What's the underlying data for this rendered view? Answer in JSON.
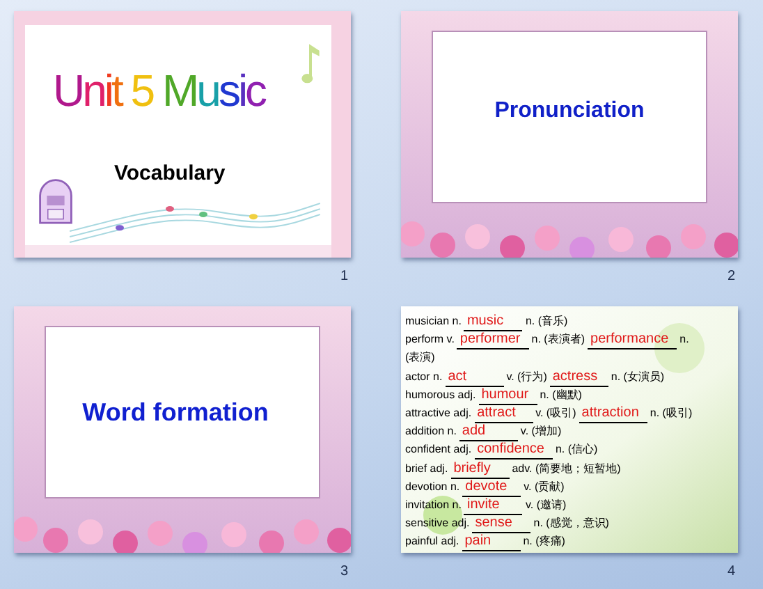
{
  "slides": [
    {
      "kind": "title",
      "number": "1",
      "title_words": [
        [
          {
            "char": "U",
            "color": "#b0188c"
          },
          {
            "char": "n",
            "color": "#e0206a"
          },
          {
            "char": "i",
            "color": "#f03a20"
          },
          {
            "char": "t",
            "color": "#f07010"
          }
        ],
        [
          {
            "char": "5",
            "color": "#f0c010"
          }
        ],
        [
          {
            "char": "M",
            "color": "#50a828"
          },
          {
            "char": "u",
            "color": "#18a0a8"
          },
          {
            "char": "s",
            "color": "#2038d0"
          },
          {
            "char": "i",
            "color": "#5830c0"
          },
          {
            "char": "c",
            "color": "#9020b0"
          }
        ]
      ],
      "subtitle": "Vocabulary"
    },
    {
      "kind": "heading",
      "number": "2",
      "heading": "Pronunciation"
    },
    {
      "kind": "heading",
      "number": "3",
      "heading": "Word formation"
    },
    {
      "kind": "list",
      "number": "4",
      "rows": [
        [
          {
            "kind": "text",
            "text": "musician n."
          },
          {
            "kind": "answer",
            "text": "music"
          },
          {
            "kind": "text",
            "text": "n. (音乐)"
          }
        ],
        [
          {
            "kind": "text",
            "text": "perform v."
          },
          {
            "kind": "answer",
            "text": "performer"
          },
          {
            "kind": "text",
            "text": "n. (表演者)"
          },
          {
            "kind": "answer",
            "text": "performance"
          },
          {
            "kind": "text",
            "text": "n."
          }
        ],
        [
          {
            "kind": "text",
            "text": "(表演)"
          }
        ],
        [
          {
            "kind": "text",
            "text": "actor n."
          },
          {
            "kind": "answer",
            "text": "act"
          },
          {
            "kind": "text",
            "text": "v. (行为)"
          },
          {
            "kind": "answer",
            "text": "actress"
          },
          {
            "kind": "text",
            "text": "n. (女演员)"
          }
        ],
        [
          {
            "kind": "text",
            "text": "humorous adj."
          },
          {
            "kind": "answer",
            "text": "humour"
          },
          {
            "kind": "text",
            "text": "n. (幽默)"
          }
        ],
        [
          {
            "kind": "text",
            "text": "attractive adj."
          },
          {
            "kind": "answer",
            "text": "attract"
          },
          {
            "kind": "text",
            "text": "v. (吸引)"
          },
          {
            "kind": "answer",
            "text": "attraction"
          },
          {
            "kind": "text",
            "text": "n. (吸引)"
          }
        ],
        [
          {
            "kind": "text",
            "text": "addition n."
          },
          {
            "kind": "answer",
            "text": "add"
          },
          {
            "kind": "text",
            "text": "v. (增加)"
          }
        ],
        [
          {
            "kind": "text",
            "text": "confident adj."
          },
          {
            "kind": "answer",
            "text": "confidence"
          },
          {
            "kind": "text",
            "text": "n. (信心)"
          }
        ],
        [
          {
            "kind": "text",
            "text": "brief adj."
          },
          {
            "kind": "answer",
            "text": "briefly"
          },
          {
            "kind": "text",
            "text": "adv. (简要地；短暂地)"
          }
        ],
        [
          {
            "kind": "text",
            "text": "devotion n."
          },
          {
            "kind": "answer",
            "text": "devote"
          },
          {
            "kind": "text",
            "text": "v. (贡献)"
          }
        ],
        [
          {
            "kind": "text",
            "text": "invitation n."
          },
          {
            "kind": "answer",
            "text": "invite"
          },
          {
            "kind": "text",
            "text": "v. (邀请)"
          }
        ],
        [
          {
            "kind": "text",
            "text": "sensitive adj."
          },
          {
            "kind": "answer",
            "text": "sense"
          },
          {
            "kind": "text",
            "text": "n. (感觉，意识)"
          }
        ],
        [
          {
            "kind": "text",
            "text": "painful adj."
          },
          {
            "kind": "answer",
            "text": "pain"
          },
          {
            "kind": "text",
            "text": "n. (疼痛)"
          }
        ]
      ]
    }
  ]
}
